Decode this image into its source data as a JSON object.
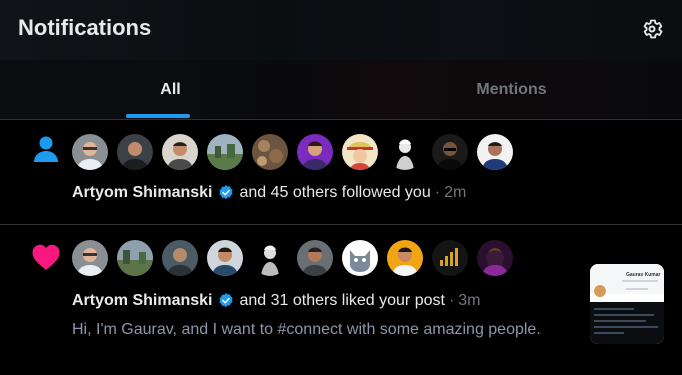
{
  "header": {
    "title": "Notifications",
    "settings_icon": "gear-icon"
  },
  "tabs": [
    {
      "label": "All",
      "active": true
    },
    {
      "label": "Mentions",
      "active": false
    }
  ],
  "colors": {
    "accent": "#1d9bf0",
    "like": "#f91880",
    "muted": "#71767b",
    "divider": "#2f3336"
  },
  "notifications": [
    {
      "type": "follow",
      "icon": "person-icon",
      "name": "Artyom Shimanski",
      "verified": true,
      "action": "and 45 others followed you",
      "separator": "·",
      "time": "2m",
      "avatar_count": 10
    },
    {
      "type": "like",
      "icon": "heart-icon",
      "name": "Artyom Shimanski",
      "verified": true,
      "action": "and 31 others liked your post",
      "separator": "·",
      "time": "3m",
      "excerpt": "Hi, I'm Gaurav, and I want to #connect with some amazing people.",
      "thumbnail_caption": "Gaurav Kumar",
      "avatar_count": 10
    }
  ]
}
